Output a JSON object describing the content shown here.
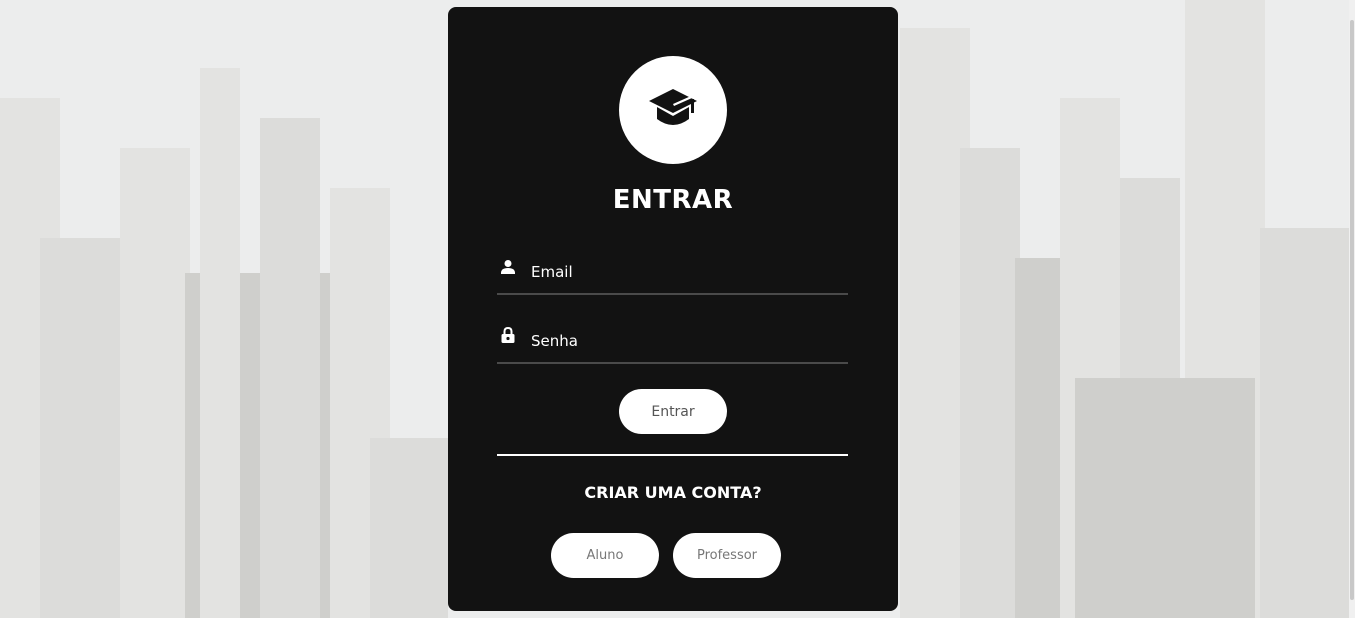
{
  "login": {
    "title": "ENTRAR",
    "email": {
      "placeholder": "Email",
      "icon": "person-icon"
    },
    "password": {
      "placeholder": "Senha",
      "icon": "lock-icon"
    },
    "submit_label": "Entrar",
    "create_account_label": "CRIAR UMA CONTA?",
    "signup_buttons": [
      "Aluno",
      "Professor"
    ],
    "logo_icon": "graduation-cap-icon"
  },
  "colors": {
    "card_background": "#121212",
    "page_background": "#eceded",
    "button_background": "#ffffff",
    "text": "#ffffff"
  }
}
